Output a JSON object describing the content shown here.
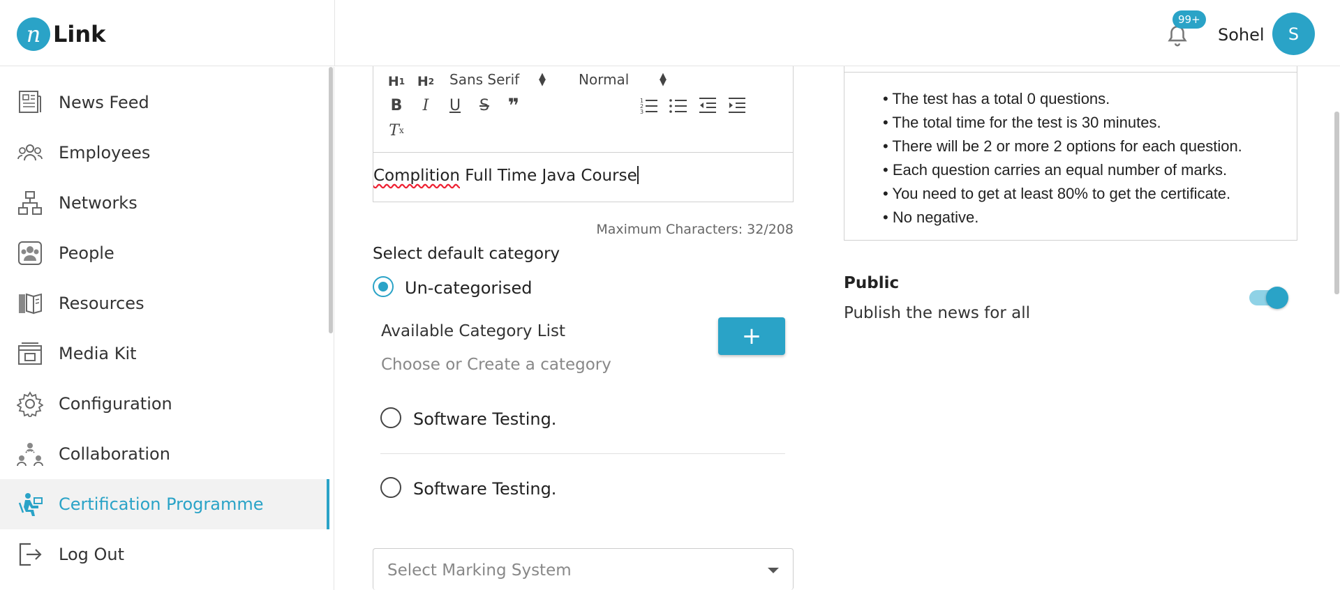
{
  "brand": {
    "logo_letter": "n",
    "name": "Link",
    "accent": "#2aa3c7"
  },
  "header": {
    "notification_badge": "99+",
    "user_name": "Sohel",
    "avatar_initial": "S"
  },
  "sidebar": {
    "items": [
      {
        "label": "News Feed",
        "icon": "news-feed-icon"
      },
      {
        "label": "Employees",
        "icon": "employees-icon"
      },
      {
        "label": "Networks",
        "icon": "networks-icon"
      },
      {
        "label": "People",
        "icon": "people-icon"
      },
      {
        "label": "Resources",
        "icon": "resources-icon"
      },
      {
        "label": "Media Kit",
        "icon": "media-kit-icon"
      },
      {
        "label": "Configuration",
        "icon": "gear-icon"
      },
      {
        "label": "Collaboration",
        "icon": "collaboration-icon"
      },
      {
        "label": "Certification Programme",
        "icon": "certification-icon",
        "active": true
      },
      {
        "label": "Log Out",
        "icon": "logout-icon"
      }
    ]
  },
  "editor": {
    "font_family_value": "Sans Serif",
    "font_size_value": "Normal",
    "content_misspelled": "Complition",
    "content_rest": " Full Time Java Course",
    "max_characters": "Maximum Characters: 32/208"
  },
  "category": {
    "title": "Select default category",
    "default_option": "Un-categorised",
    "available_label": "Available Category List",
    "placeholder": "Choose or Create a category",
    "add_button": "+",
    "options": [
      "Software Testing.",
      "Software Testing."
    ]
  },
  "marking": {
    "placeholder": "Select Marking System"
  },
  "instructions": [
    "• The test has a total 0 questions.",
    "• The total time for the test is 30 minutes.",
    "• There will be 2 or more 2 options for each question.",
    "• Each question carries an equal number of marks.",
    "• You need to get at least 80% to get the certificate.",
    "• No negative."
  ],
  "public": {
    "title": "Public",
    "description": "Publish the news for all",
    "enabled": true
  }
}
